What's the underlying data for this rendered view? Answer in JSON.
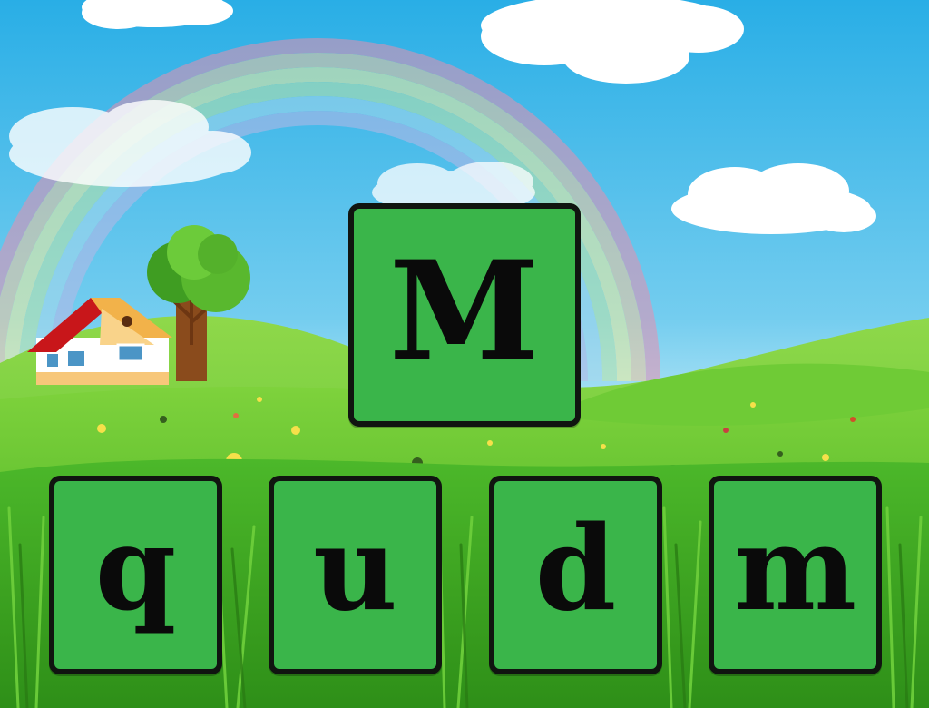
{
  "game": {
    "target_letter": "M",
    "choices": [
      {
        "letter": "q"
      },
      {
        "letter": "u"
      },
      {
        "letter": "d"
      },
      {
        "letter": "m"
      }
    ]
  },
  "colors": {
    "tile_fill": "#3ab54a",
    "tile_border": "#101510",
    "sky_top": "#2fb4e8",
    "sky_bottom": "#a8e4f6",
    "grass": "#4cbf2a"
  }
}
